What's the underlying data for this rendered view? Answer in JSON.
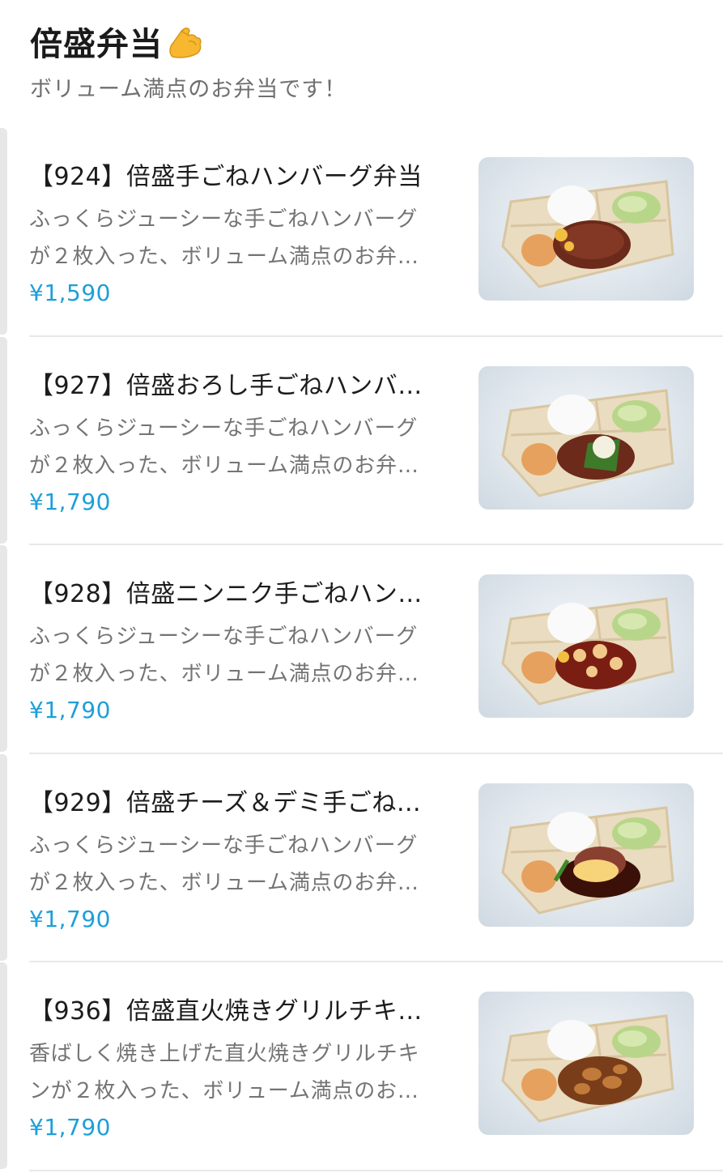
{
  "section": {
    "title": "倍盛弁当",
    "title_icon": "flexed-biceps-icon",
    "subtitle": "ボリューム満点のお弁当です！"
  },
  "colors": {
    "price": "#1e9fd8",
    "divider": "#e8e8e8",
    "edge_bar": "#e7e7e7"
  },
  "items": [
    {
      "name": "【924】倍盛手ごねハンバーグ弁当",
      "desc_line1": "ふっくらジューシーな手ごねハンバーグ",
      "desc_line2": "が２枚入った、ボリューム満点のお弁…",
      "price": "¥1,590",
      "image": "hamburg-steak-bento-photo"
    },
    {
      "name": "【927】倍盛おろし手ごねハンバ…",
      "desc_line1": "ふっくらジューシーな手ごねハンバーグ",
      "desc_line2": "が２枚入った、ボリューム満点のお弁…",
      "price": "¥1,790",
      "image": "grated-radish-hamburg-bento-photo"
    },
    {
      "name": "【928】倍盛ニンニク手ごねハン…",
      "desc_line1": "ふっくらジューシーな手ごねハンバーグ",
      "desc_line2": "が２枚入った、ボリューム満点のお弁…",
      "price": "¥1,790",
      "image": "garlic-hamburg-bento-photo"
    },
    {
      "name": "【929】倍盛チーズ＆デミ手ごね…",
      "desc_line1": "ふっくらジューシーな手ごねハンバーグ",
      "desc_line2": "が２枚入った、ボリューム満点のお弁…",
      "price": "¥1,790",
      "image": "cheese-demi-hamburg-bento-photo"
    },
    {
      "name": "【936】倍盛直火焼きグリルチキ…",
      "desc_line1": "香ばしく焼き上げた直火焼きグリルチキ",
      "desc_line2": "ンが２枚入った、ボリューム満点のお…",
      "price": "¥1,790",
      "image": "grilled-chicken-bento-photo"
    }
  ]
}
